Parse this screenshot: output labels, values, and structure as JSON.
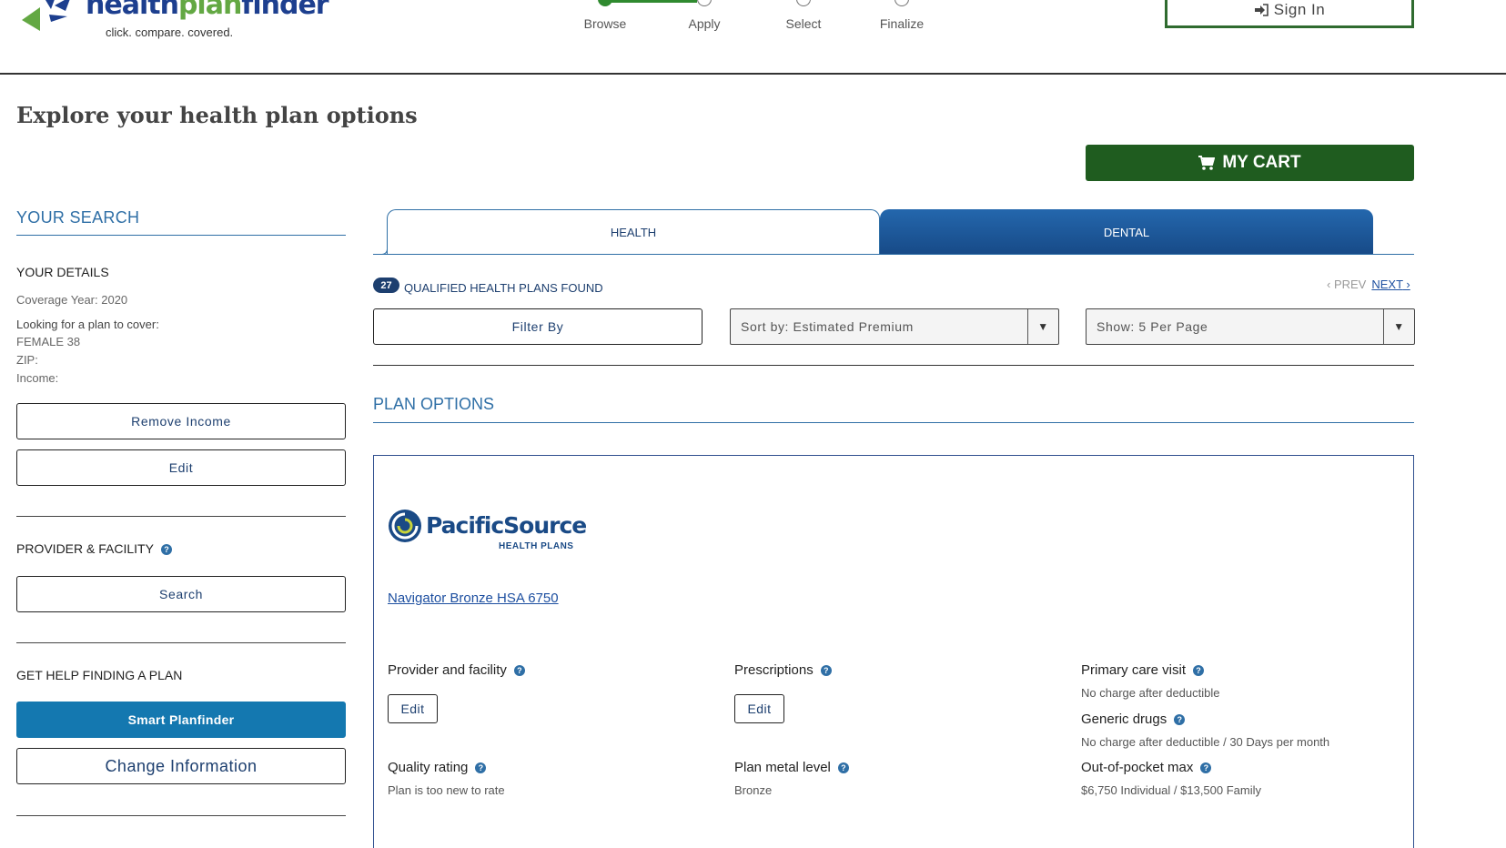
{
  "header": {
    "logo_health": "health",
    "logo_plan": "plan",
    "logo_finder": "finder",
    "tagline": "click. compare. covered.",
    "steps": [
      "Browse",
      "Apply",
      "Select",
      "Finalize"
    ],
    "sign_in_label": "Sign In"
  },
  "page_title": "Explore your health plan options",
  "cart_label": "MY CART",
  "sidebar": {
    "heading": "YOUR SEARCH",
    "details_label": "YOUR DETAILS",
    "coverage_year": "Coverage Year: 2020",
    "looking_for": "Looking for a plan to cover:",
    "member": "FEMALE 38",
    "zip": "ZIP:",
    "income": "Income:",
    "remove_income_label": "Remove Income",
    "edit_label": "Edit",
    "provider_label": "PROVIDER & FACILITY",
    "search_label": "Search",
    "help_label": "GET HELP FINDING A PLAN",
    "smart_planfinder_label": "Smart Planfinder",
    "change_info_label": "Change Information"
  },
  "tabs": [
    {
      "label": "HEALTH",
      "active": true
    },
    {
      "label": "DENTAL",
      "active": false
    }
  ],
  "results": {
    "count": "27",
    "count_text": "QUALIFIED HEALTH PLANS FOUND",
    "prev_label": "PREV",
    "next_label": "NEXT",
    "filter_label": "Filter By",
    "sort_value": "Sort by: Estimated Premium",
    "show_value": "Show: 5 Per Page"
  },
  "plan_options_heading": "PLAN OPTIONS",
  "plan": {
    "carrier_name": "PacificSource",
    "carrier_sub": "HEALTH PLANS",
    "name": "Navigator Bronze HSA 6750",
    "provider_label": "Provider and facility",
    "provider_edit": "Edit",
    "prescriptions_label": "Prescriptions",
    "prescriptions_edit": "Edit",
    "primary_care_label": "Primary care visit",
    "primary_care_value": "No charge after deductible",
    "generic_drugs_label": "Generic drugs",
    "generic_drugs_value": "No charge after deductible / 30 Days per month",
    "quality_label": "Quality rating",
    "quality_value": "Plan is too new to rate",
    "metal_label": "Plan metal level",
    "metal_value": "Bronze",
    "oop_label": "Out-of-pocket max",
    "oop_value": "$6,750 Individual / $13,500 Family"
  },
  "colors": {
    "brand_blue": "#1d3f8f",
    "brand_green": "#63a843",
    "cart_green": "#1f5c1f",
    "link_blue": "#1d4fa0",
    "primary_button": "#1478b0"
  },
  "icons": [
    "healthplanfinder-logo",
    "sign-in-icon",
    "cart-icon",
    "help-icon",
    "caret-down-icon",
    "chevron-left-icon",
    "chevron-right-icon",
    "pacificsource-logo"
  ]
}
